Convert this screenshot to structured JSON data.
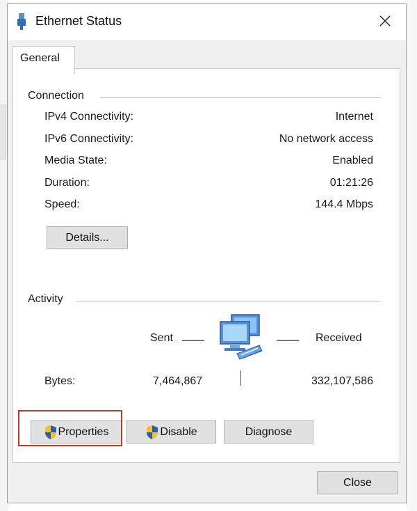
{
  "window": {
    "title": "Ethernet Status",
    "icon": "ethernet-icon",
    "close_icon": "close-icon"
  },
  "tabs": [
    {
      "label": "General"
    }
  ],
  "connection": {
    "heading": "Connection",
    "rows": [
      {
        "label": "IPv4 Connectivity:",
        "value": "Internet"
      },
      {
        "label": "IPv6 Connectivity:",
        "value": "No network access"
      },
      {
        "label": "Media State:",
        "value": "Enabled"
      },
      {
        "label": "Duration:",
        "value": "01:21:26"
      },
      {
        "label": "Speed:",
        "value": "144.4 Mbps"
      }
    ],
    "details_button": "Details..."
  },
  "activity": {
    "heading": "Activity",
    "sent_label": "Sent",
    "received_label": "Received",
    "bytes_label": "Bytes:",
    "bytes_sent": "7,464,867",
    "bytes_received": "332,107,586",
    "icon": "network-computers-icon"
  },
  "buttons": {
    "properties": "Properties",
    "disable": "Disable",
    "diagnose": "Diagnose",
    "close": "Close"
  },
  "colors": {
    "highlight": "#c0392b",
    "dialog_bg": "#f0f0f0",
    "button_bg": "#e1e1e1"
  }
}
